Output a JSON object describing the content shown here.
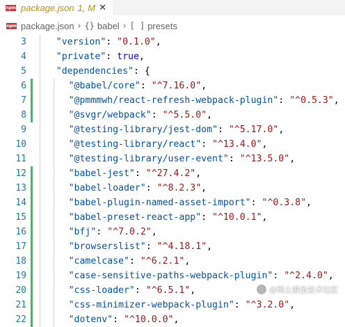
{
  "tab": {
    "icon": "npm-icon",
    "badge_text": "npm",
    "file_name": "package.json",
    "status": "1, M",
    "close_glyph": "✕"
  },
  "breadcrumb": {
    "items": [
      {
        "icon": "npm-icon",
        "badge_text": "npm",
        "label": "package.json"
      },
      {
        "icon": "braces-icon",
        "symbol": "{}",
        "label": "babel"
      },
      {
        "icon": "brackets-icon",
        "symbol": "[ ]",
        "label": "presets"
      }
    ],
    "separator": "›"
  },
  "editor": {
    "lines": [
      {
        "n": "3",
        "modified": false,
        "indent": 1,
        "parts": [
          [
            "k",
            "\"version\""
          ],
          [
            "p",
            ": "
          ],
          [
            "s",
            "\"0.1.0\""
          ],
          [
            "p",
            ","
          ]
        ]
      },
      {
        "n": "4",
        "modified": false,
        "indent": 1,
        "parts": [
          [
            "k",
            "\"private\""
          ],
          [
            "p",
            ": "
          ],
          [
            "c",
            "true"
          ],
          [
            "p",
            ","
          ]
        ]
      },
      {
        "n": "5",
        "modified": false,
        "indent": 1,
        "parts": [
          [
            "k",
            "\"dependencies\""
          ],
          [
            "p",
            ": {"
          ]
        ]
      },
      {
        "n": "6",
        "modified": true,
        "indent": 2,
        "parts": [
          [
            "k",
            "\"@babel/core\""
          ],
          [
            "p",
            ": "
          ],
          [
            "s",
            "\"^7.16.0\""
          ],
          [
            "p",
            ","
          ]
        ]
      },
      {
        "n": "7",
        "modified": true,
        "indent": 2,
        "parts": [
          [
            "k",
            "\"@pmmmwh/react-refresh-webpack-plugin\""
          ],
          [
            "p",
            ": "
          ],
          [
            "s",
            "\"^0.5.3\""
          ],
          [
            "p",
            ","
          ]
        ]
      },
      {
        "n": "8",
        "modified": true,
        "indent": 2,
        "parts": [
          [
            "k",
            "\"@svgr/webpack\""
          ],
          [
            "p",
            ": "
          ],
          [
            "s",
            "\"^5.5.0\""
          ],
          [
            "p",
            ","
          ]
        ]
      },
      {
        "n": "9",
        "modified": false,
        "indent": 2,
        "parts": [
          [
            "k",
            "\"@testing-library/jest-dom\""
          ],
          [
            "p",
            ": "
          ],
          [
            "s",
            "\"^5.17.0\""
          ],
          [
            "p",
            ","
          ]
        ]
      },
      {
        "n": "10",
        "modified": false,
        "indent": 2,
        "parts": [
          [
            "k",
            "\"@testing-library/react\""
          ],
          [
            "p",
            ": "
          ],
          [
            "s",
            "\"^13.4.0\""
          ],
          [
            "p",
            ","
          ]
        ]
      },
      {
        "n": "11",
        "modified": false,
        "indent": 2,
        "parts": [
          [
            "k",
            "\"@testing-library/user-event\""
          ],
          [
            "p",
            ": "
          ],
          [
            "s",
            "\"^13.5.0\""
          ],
          [
            "p",
            ","
          ]
        ]
      },
      {
        "n": "12",
        "modified": true,
        "indent": 2,
        "parts": [
          [
            "k",
            "\"babel-jest\""
          ],
          [
            "p",
            ": "
          ],
          [
            "s",
            "\"^27.4.2\""
          ],
          [
            "p",
            ","
          ]
        ]
      },
      {
        "n": "13",
        "modified": true,
        "indent": 2,
        "parts": [
          [
            "k",
            "\"babel-loader\""
          ],
          [
            "p",
            ": "
          ],
          [
            "s",
            "\"^8.2.3\""
          ],
          [
            "p",
            ","
          ]
        ]
      },
      {
        "n": "14",
        "modified": true,
        "indent": 2,
        "parts": [
          [
            "k",
            "\"babel-plugin-named-asset-import\""
          ],
          [
            "p",
            ": "
          ],
          [
            "s",
            "\"^0.3.8\""
          ],
          [
            "p",
            ","
          ]
        ]
      },
      {
        "n": "15",
        "modified": true,
        "indent": 2,
        "parts": [
          [
            "k",
            "\"babel-preset-react-app\""
          ],
          [
            "p",
            ": "
          ],
          [
            "s",
            "\"^10.0.1\""
          ],
          [
            "p",
            ","
          ]
        ]
      },
      {
        "n": "16",
        "modified": true,
        "indent": 2,
        "parts": [
          [
            "k",
            "\"bfj\""
          ],
          [
            "p",
            ": "
          ],
          [
            "s",
            "\"^7.0.2\""
          ],
          [
            "p",
            ","
          ]
        ]
      },
      {
        "n": "17",
        "modified": true,
        "indent": 2,
        "parts": [
          [
            "k",
            "\"browserslist\""
          ],
          [
            "p",
            ": "
          ],
          [
            "s",
            "\"^4.18.1\""
          ],
          [
            "p",
            ","
          ]
        ]
      },
      {
        "n": "18",
        "modified": true,
        "indent": 2,
        "parts": [
          [
            "k",
            "\"camelcase\""
          ],
          [
            "p",
            ": "
          ],
          [
            "s",
            "\"^6.2.1\""
          ],
          [
            "p",
            ","
          ]
        ]
      },
      {
        "n": "19",
        "modified": true,
        "indent": 2,
        "parts": [
          [
            "k",
            "\"case-sensitive-paths-webpack-plugin\""
          ],
          [
            "p",
            ": "
          ],
          [
            "s",
            "\"^2.4.0\""
          ],
          [
            "p",
            ","
          ]
        ]
      },
      {
        "n": "20",
        "modified": true,
        "indent": 2,
        "parts": [
          [
            "k",
            "\"css-loader\""
          ],
          [
            "p",
            ": "
          ],
          [
            "s",
            "\"^6.5.1\""
          ],
          [
            "p",
            ","
          ]
        ]
      },
      {
        "n": "21",
        "modified": true,
        "indent": 2,
        "parts": [
          [
            "k",
            "\"css-minimizer-webpack-plugin\""
          ],
          [
            "p",
            ": "
          ],
          [
            "s",
            "\"^3.2.0\""
          ],
          [
            "p",
            ","
          ]
        ]
      },
      {
        "n": "22",
        "modified": true,
        "indent": 2,
        "parts": [
          [
            "k",
            "\"dotenv\""
          ],
          [
            "p",
            ": "
          ],
          [
            "s",
            "\"^10.0.0\""
          ],
          [
            "p",
            ","
          ]
        ]
      }
    ]
  },
  "colors": {
    "key": "#0451a5",
    "string": "#a31515",
    "keyword": "#0000ff",
    "line_number": "#237893",
    "modified_gutter": "#5aa972",
    "tab_modified_text": "#b89500"
  },
  "watermark": {
    "text": "@稀土掘金技术社区"
  }
}
